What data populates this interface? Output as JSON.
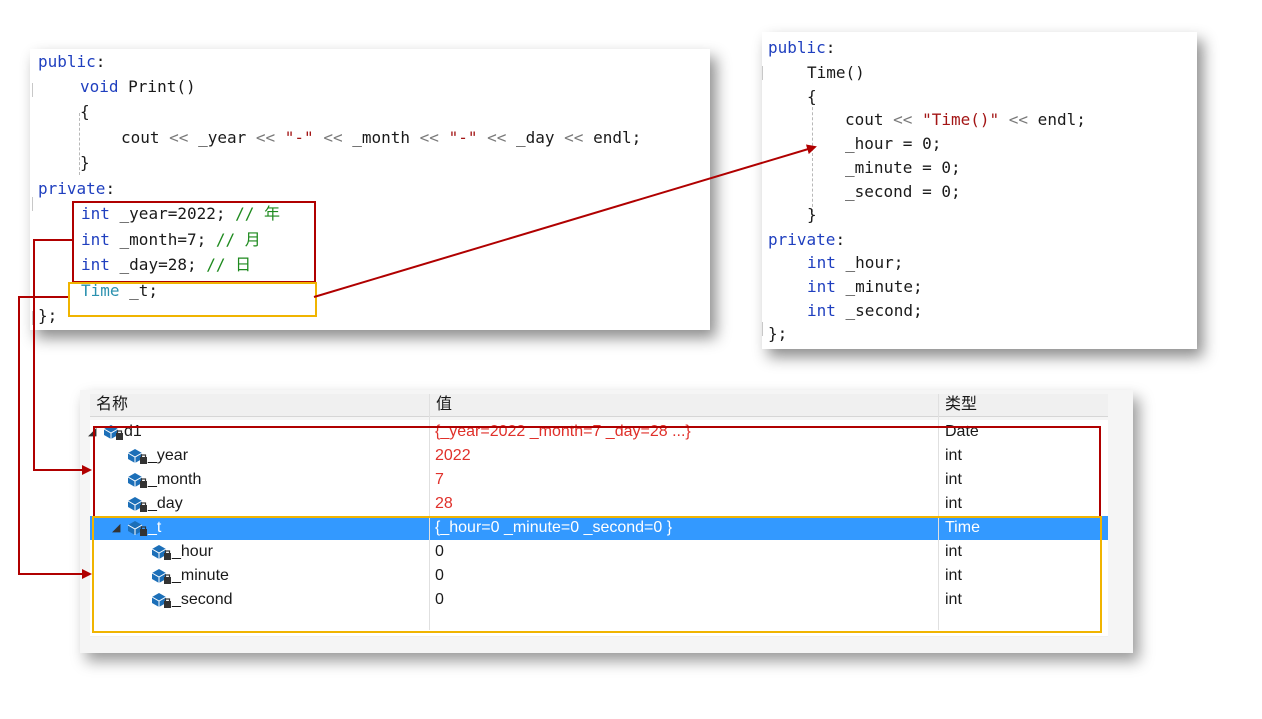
{
  "left_code": {
    "lines": [
      {
        "parts": [
          {
            "t": "public",
            "c": "kw"
          },
          {
            "t": ":",
            "c": ""
          }
        ]
      },
      {
        "parts": [
          {
            "t": "void",
            "c": "kw"
          },
          {
            "t": " Print()",
            "c": ""
          }
        ]
      },
      {
        "parts": [
          {
            "t": "{",
            "c": ""
          }
        ]
      },
      {
        "parts": [
          {
            "t": "cout ",
            "c": ""
          },
          {
            "t": "<<",
            "c": "op"
          },
          {
            "t": " _year ",
            "c": ""
          },
          {
            "t": "<<",
            "c": "op"
          },
          {
            "t": " ",
            "c": ""
          },
          {
            "t": "\"-\"",
            "c": "str"
          },
          {
            "t": " ",
            "c": ""
          },
          {
            "t": "<<",
            "c": "op"
          },
          {
            "t": " _month ",
            "c": ""
          },
          {
            "t": "<<",
            "c": "op"
          },
          {
            "t": " ",
            "c": ""
          },
          {
            "t": "\"-\"",
            "c": "str"
          },
          {
            "t": " ",
            "c": ""
          },
          {
            "t": "<<",
            "c": "op"
          },
          {
            "t": " _day ",
            "c": ""
          },
          {
            "t": "<<",
            "c": "op"
          },
          {
            "t": " endl;",
            "c": ""
          }
        ]
      },
      {
        "parts": [
          {
            "t": "}",
            "c": ""
          }
        ]
      },
      {
        "parts": [
          {
            "t": "private",
            "c": "kw"
          },
          {
            "t": ":",
            "c": ""
          }
        ]
      },
      {
        "parts": [
          {
            "t": "int",
            "c": "kw"
          },
          {
            "t": " _year=2022; ",
            "c": ""
          },
          {
            "t": "// 年",
            "c": "cmt"
          }
        ]
      },
      {
        "parts": [
          {
            "t": "int",
            "c": "kw"
          },
          {
            "t": " _month=7; ",
            "c": ""
          },
          {
            "t": "// 月",
            "c": "cmt"
          }
        ]
      },
      {
        "parts": [
          {
            "t": "int",
            "c": "kw"
          },
          {
            "t": " _day=28; ",
            "c": ""
          },
          {
            "t": "// 日",
            "c": "cmt"
          }
        ]
      },
      {
        "parts": [
          {
            "t": "Time",
            "c": "kw2"
          },
          {
            "t": " _t;",
            "c": ""
          }
        ]
      },
      {
        "parts": [
          {
            "t": "};",
            "c": ""
          }
        ]
      }
    ]
  },
  "right_code": {
    "lines": [
      {
        "parts": [
          {
            "t": "public",
            "c": "kw"
          },
          {
            "t": ":",
            "c": ""
          }
        ]
      },
      {
        "parts": [
          {
            "t": "Time()",
            "c": ""
          }
        ]
      },
      {
        "parts": [
          {
            "t": "{",
            "c": ""
          }
        ]
      },
      {
        "parts": [
          {
            "t": "cout ",
            "c": ""
          },
          {
            "t": "<<",
            "c": "op"
          },
          {
            "t": " ",
            "c": ""
          },
          {
            "t": "\"Time()\"",
            "c": "str"
          },
          {
            "t": " ",
            "c": ""
          },
          {
            "t": "<<",
            "c": "op"
          },
          {
            "t": " endl;",
            "c": ""
          }
        ]
      },
      {
        "parts": [
          {
            "t": "_hour = 0;",
            "c": ""
          }
        ]
      },
      {
        "parts": [
          {
            "t": "_minute = 0;",
            "c": ""
          }
        ]
      },
      {
        "parts": [
          {
            "t": "_second = 0;",
            "c": ""
          }
        ]
      },
      {
        "parts": [
          {
            "t": "}",
            "c": ""
          }
        ]
      },
      {
        "parts": [
          {
            "t": "private",
            "c": "kw"
          },
          {
            "t": ":",
            "c": ""
          }
        ]
      },
      {
        "parts": [
          {
            "t": "int",
            "c": "kw"
          },
          {
            "t": " _hour;",
            "c": ""
          }
        ]
      },
      {
        "parts": [
          {
            "t": "int",
            "c": "kw"
          },
          {
            "t": " _minute;",
            "c": ""
          }
        ]
      },
      {
        "parts": [
          {
            "t": "int",
            "c": "kw"
          },
          {
            "t": " _second;",
            "c": ""
          }
        ]
      },
      {
        "parts": [
          {
            "t": "};",
            "c": ""
          }
        ]
      }
    ]
  },
  "debug": {
    "headers": {
      "name": "名称",
      "value": "值",
      "type": "类型"
    },
    "rows": [
      {
        "name": "d1",
        "value": "{_year=2022 _month=7 _day=28 ...}",
        "type": "Date",
        "red": true,
        "expander": "◢",
        "level": 0
      },
      {
        "name": "_year",
        "value": "2022",
        "type": "int",
        "red": true,
        "level": 1
      },
      {
        "name": "_month",
        "value": "7",
        "type": "int",
        "red": true,
        "level": 1
      },
      {
        "name": "_day",
        "value": "28",
        "type": "int",
        "red": true,
        "level": 1
      },
      {
        "name": "_t",
        "value": "{_hour=0 _minute=0 _second=0 }",
        "type": "Time",
        "selected": true,
        "expander": "◢",
        "level": 1
      },
      {
        "name": "_hour",
        "value": "0",
        "type": "int",
        "level": 2
      },
      {
        "name": "_minute",
        "value": "0",
        "type": "int",
        "level": 2
      },
      {
        "name": "_second",
        "value": "0",
        "type": "int",
        "level": 2
      }
    ]
  },
  "colors": {
    "red_box": "#b00000",
    "yellow_box": "#f0b400",
    "selection": "#3399ff",
    "keyword": "#1f3fbf"
  }
}
